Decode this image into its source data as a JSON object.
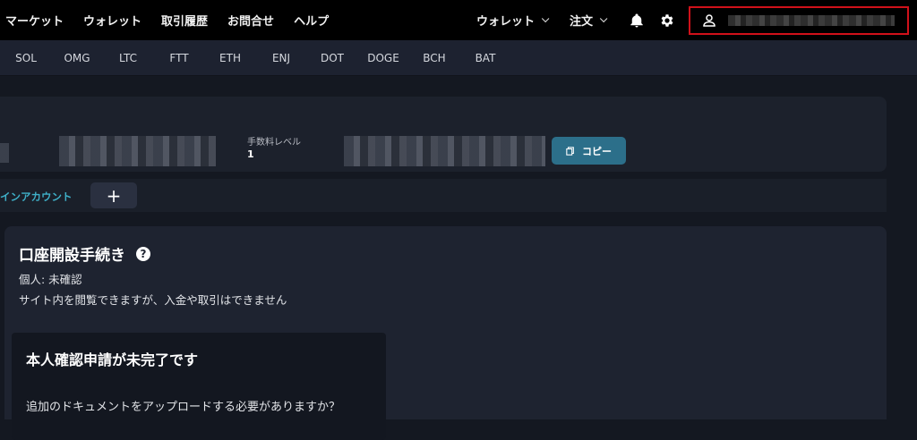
{
  "nav": {
    "links": [
      "マーケット",
      "ウォレット",
      "取引履歴",
      "お問合せ",
      "ヘルプ"
    ],
    "wallet_dropdown": "ウォレット",
    "order_dropdown": "注文"
  },
  "ticker": {
    "coins": [
      "SOL",
      "OMG",
      "LTC",
      "FTT",
      "ETH",
      "ENJ",
      "DOT",
      "DOGE",
      "BCH",
      "BAT"
    ]
  },
  "account": {
    "fee_level_label": "手数料レベル",
    "fee_level_value": "1",
    "copy_label": "コピー"
  },
  "tabs": {
    "main_account": "インアカウント",
    "add_symbol": "+"
  },
  "onboarding": {
    "title": "口座開設手続き",
    "status": "個人: 未確認",
    "description": "サイト内を閲覧できますが、入金や取引はできません",
    "card_title": "本人確認申請が未完了です",
    "card_question": "追加のドキュメントをアップロードする必要がありますか？"
  },
  "colors": {
    "accent": "#3fb0c8",
    "copy_button": "#2c6f8a",
    "highlight_box": "#d0111a"
  }
}
